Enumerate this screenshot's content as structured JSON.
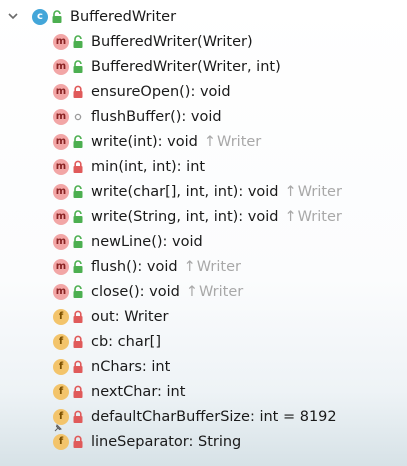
{
  "tree": {
    "root": {
      "label": "BufferedWriter",
      "kind": "c"
    },
    "items": [
      {
        "label": "BufferedWriter(Writer)",
        "kind": "m",
        "visibility": "public",
        "inherited": ""
      },
      {
        "label": "BufferedWriter(Writer, int)",
        "kind": "m",
        "visibility": "public",
        "inherited": ""
      },
      {
        "label": "ensureOpen(): void",
        "kind": "m",
        "visibility": "private",
        "inherited": ""
      },
      {
        "label": "flushBuffer(): void",
        "kind": "m",
        "visibility": "package",
        "inherited": ""
      },
      {
        "label": "write(int): void",
        "kind": "m",
        "visibility": "public",
        "inherited": "Writer"
      },
      {
        "label": "min(int, int): int",
        "kind": "m",
        "visibility": "private",
        "inherited": ""
      },
      {
        "label": "write(char[], int, int): void",
        "kind": "m",
        "visibility": "public",
        "inherited": "Writer"
      },
      {
        "label": "write(String, int, int): void",
        "kind": "m",
        "visibility": "public",
        "inherited": "Writer"
      },
      {
        "label": "newLine(): void",
        "kind": "m",
        "visibility": "public",
        "inherited": ""
      },
      {
        "label": "flush(): void",
        "kind": "m",
        "visibility": "public",
        "inherited": "Writer"
      },
      {
        "label": "close(): void",
        "kind": "m",
        "visibility": "public",
        "inherited": "Writer"
      },
      {
        "label": "out: Writer",
        "kind": "f",
        "visibility": "private",
        "inherited": ""
      },
      {
        "label": "cb: char[]",
        "kind": "f",
        "visibility": "private",
        "inherited": ""
      },
      {
        "label": "nChars: int",
        "kind": "f",
        "visibility": "private",
        "inherited": ""
      },
      {
        "label": "nextChar: int",
        "kind": "f",
        "visibility": "private",
        "inherited": ""
      },
      {
        "label": "defaultCharBufferSize: int = 8192",
        "kind": "f",
        "visibility": "private",
        "inherited": "",
        "static": true
      },
      {
        "label": "lineSeparator: String",
        "kind": "f",
        "visibility": "private",
        "inherited": ""
      }
    ]
  },
  "icons": {
    "collapse": "chevron-down-icon",
    "class": "class-icon",
    "method": "method-icon",
    "field": "field-icon",
    "public": "unlock-icon",
    "private": "lock-icon",
    "package": "circle-icon",
    "inherited": "up-arrow-icon",
    "static": "pin-icon"
  },
  "colors": {
    "class_badge": "#43a6d9",
    "method_badge": "#f2a6a6",
    "field_badge": "#f3c46b",
    "public_lock": "#4caf50",
    "private_lock": "#e05a5a",
    "inherited_text": "#a8a8a8"
  }
}
